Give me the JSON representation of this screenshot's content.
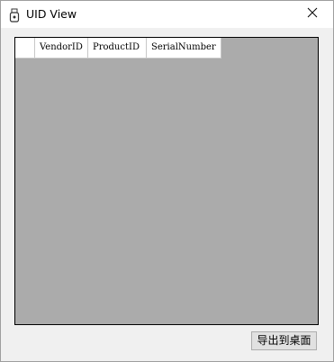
{
  "window": {
    "title": "UID View",
    "icon": "usb-drive-icon",
    "close_icon": "close-icon"
  },
  "grid": {
    "columns": [
      "VendorID",
      "ProductID",
      "SerialNumber"
    ],
    "rows": [],
    "background_color": "#ababab"
  },
  "footer": {
    "export_label": "导出到桌面"
  }
}
